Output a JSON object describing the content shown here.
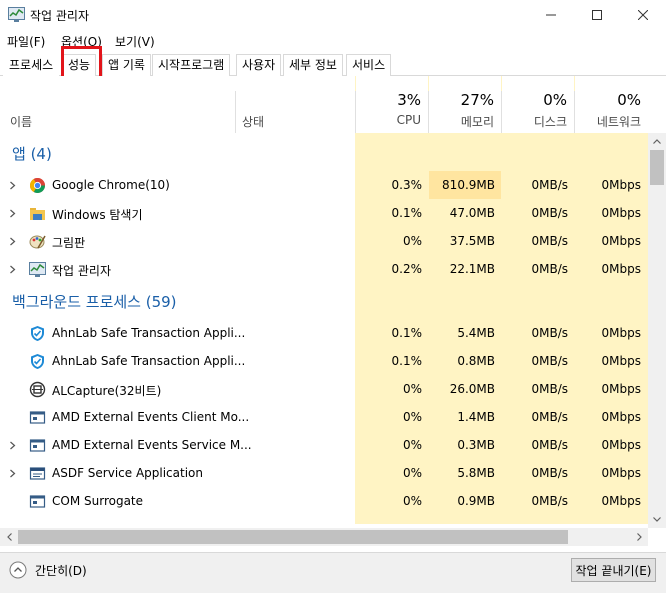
{
  "window": {
    "title": "작업 관리자"
  },
  "menu": [
    {
      "label": "파일(F)"
    },
    {
      "label": "옵션(O)"
    },
    {
      "label": "보기(V)"
    }
  ],
  "tabs": [
    {
      "label": "프로세스"
    },
    {
      "label": "성능"
    },
    {
      "label": "앱 기록"
    },
    {
      "label": "시작프로그램"
    },
    {
      "label": "사용자"
    },
    {
      "label": "세부 정보"
    },
    {
      "label": "서비스"
    }
  ],
  "columns": {
    "name": "이름",
    "status": "상태",
    "cpu": {
      "pct": "3%",
      "label": "CPU"
    },
    "memory": {
      "pct": "27%",
      "label": "메모리"
    },
    "disk": {
      "pct": "0%",
      "label": "디스크"
    },
    "network": {
      "pct": "0%",
      "label": "네트워크"
    }
  },
  "groups": {
    "apps": "앱 (4)",
    "background": "백그라운드 프로세스 (59)"
  },
  "apps": [
    {
      "name": "Google Chrome(10)",
      "icon": "chrome-icon",
      "cpu": "0.3%",
      "memory": "810.9MB",
      "disk": "0MB/s",
      "network": "0Mbps"
    },
    {
      "name": "Windows 탐색기",
      "icon": "folder-icon",
      "cpu": "0.1%",
      "memory": "47.0MB",
      "disk": "0MB/s",
      "network": "0Mbps"
    },
    {
      "name": "그림판",
      "icon": "paint-icon",
      "cpu": "0%",
      "memory": "37.5MB",
      "disk": "0MB/s",
      "network": "0Mbps"
    },
    {
      "name": "작업 관리자",
      "icon": "task-manager-icon",
      "cpu": "0.2%",
      "memory": "22.1MB",
      "disk": "0MB/s",
      "network": "0Mbps"
    }
  ],
  "background": [
    {
      "name": "AhnLab Safe Transaction Appli...",
      "icon": "shield-icon",
      "cpu": "0.1%",
      "memory": "5.4MB",
      "disk": "0MB/s",
      "network": "0Mbps"
    },
    {
      "name": "AhnLab Safe Transaction Appli...",
      "icon": "shield-icon",
      "cpu": "0.1%",
      "memory": "0.8MB",
      "disk": "0MB/s",
      "network": "0Mbps"
    },
    {
      "name": "ALCapture(32비트)",
      "icon": "capture-icon",
      "cpu": "0%",
      "memory": "26.0MB",
      "disk": "0MB/s",
      "network": "0Mbps"
    },
    {
      "name": "AMD External Events Client Mo...",
      "icon": "service-icon",
      "cpu": "0%",
      "memory": "1.4MB",
      "disk": "0MB/s",
      "network": "0Mbps"
    },
    {
      "name": "AMD External Events Service M...",
      "icon": "service-icon",
      "cpu": "0%",
      "memory": "0.3MB",
      "disk": "0MB/s",
      "network": "0Mbps"
    },
    {
      "name": "ASDF Service Application",
      "icon": "app-window-icon",
      "cpu": "0%",
      "memory": "5.8MB",
      "disk": "0MB/s",
      "network": "0Mbps"
    },
    {
      "name": "COM Surrogate",
      "icon": "service-icon",
      "cpu": "0%",
      "memory": "0.9MB",
      "disk": "0MB/s",
      "network": "0Mbps"
    }
  ],
  "footer": {
    "less_details": "간단히(D)",
    "end_task": "작업 끝내기(E)"
  }
}
